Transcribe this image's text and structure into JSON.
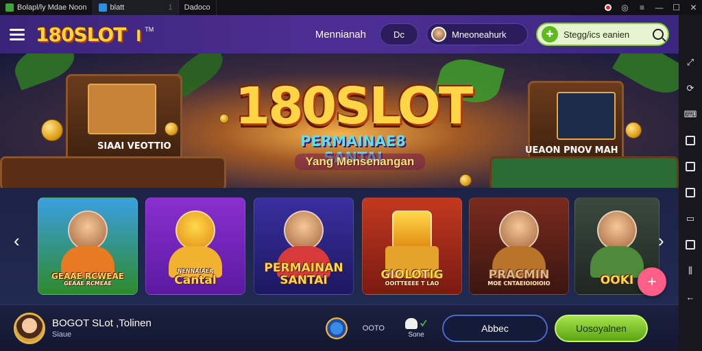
{
  "titlebar": {
    "tabs": [
      {
        "label": "Bolapl/ly Mdae Noon",
        "color": "#3fa33a"
      },
      {
        "label": "blatt",
        "color": "#2c8fe0"
      },
      {
        "label": "Dadoco",
        "color": "#333333"
      }
    ],
    "tab_separator": "1"
  },
  "app": {
    "logo": "180SLOT",
    "logo_suffix": "I",
    "logo_sup": "TM",
    "nav_link": "Mennianah",
    "small_pill": "Dc",
    "user_pill": "Mneoneahurk",
    "search_placeholder": "Stegg/ics eanien",
    "search_badge_icon": "gamepad-icon"
  },
  "hero": {
    "title": "180SLOT",
    "subtitle": "PERMAINAE8 SANTAI",
    "tagline": "Yang Mensenangan",
    "left_sign": "SIAAI VEOTTIO",
    "right_sign": "UEAON PNOV MAH"
  },
  "carousel": {
    "cards": [
      {
        "label": "GEAAE RCWEAE",
        "sub": "GEAAE RCMEAE",
        "top": "#3b9fe0",
        "bottom": "#2e8a2c",
        "body": "#e87a24"
      },
      {
        "label": "Cantal",
        "sub": "NENNAIAER",
        "top": "#8a2fd0",
        "bottom": "#5a1aa0",
        "body": "#f2b230"
      },
      {
        "label": "PERMAINAN SANTAI",
        "sub": "",
        "top": "#3a2fa0",
        "bottom": "#1c1860",
        "body": "#d63a3a"
      },
      {
        "label": "GIOLOTIG",
        "sub": "OOITTEEEE T LAO",
        "top": "#c2391e",
        "bottom": "#7a1a12",
        "body": "#e6a32c"
      },
      {
        "label": "PRACMIN",
        "sub": "MOE CNTAEIOIOIOIO",
        "top": "#7a2a1e",
        "bottom": "#3a1610",
        "body": "#b8742a"
      },
      {
        "label": "OOKI",
        "sub": "",
        "top": "#3a4a3e",
        "bottom": "#1e2620",
        "body": "#4f8a3a"
      }
    ],
    "prev_icon": "‹",
    "next_icon": "›",
    "fab_icon": "+"
  },
  "bottom": {
    "name": "BOGOT SLot ,Tolinen",
    "sub": "Siaue",
    "stat": "OOTO",
    "ghost_label": "Sone",
    "outline_button": "Abbec",
    "green_button": "Uosoyalnen"
  },
  "colors": {
    "header": "#4d2f94",
    "accent_green": "#7ccf2c",
    "logo_gold": "#ffd23a",
    "fab_pink": "#ff5e88"
  }
}
